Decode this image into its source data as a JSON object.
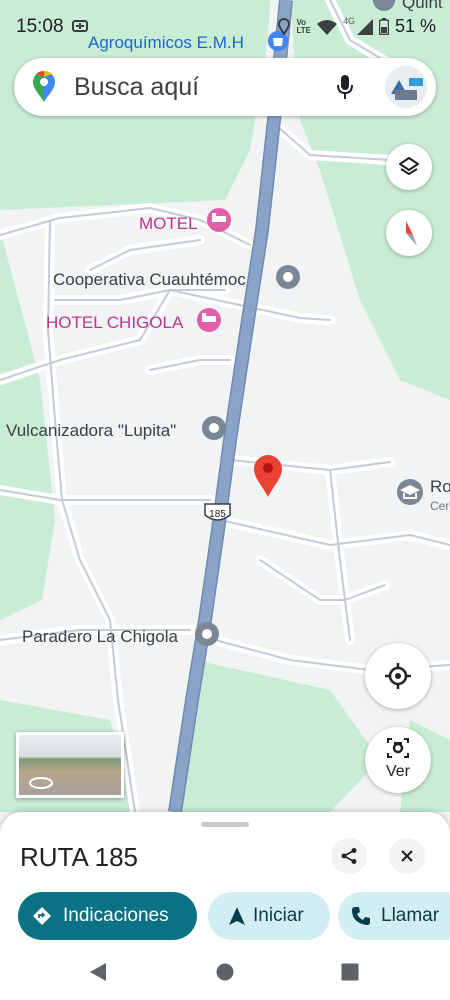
{
  "status_bar": {
    "time": "15:08",
    "battery": "51 %",
    "network_small_label": "Vo\nLTE",
    "network_gen": "4G"
  },
  "search": {
    "placeholder": "Busca aquí"
  },
  "map": {
    "pois": [
      {
        "id": "agroquimicos",
        "label": "Agroquímicos E.M.H",
        "category": "shop"
      },
      {
        "id": "quinta",
        "label": "Quint",
        "category": "place"
      },
      {
        "id": "motel",
        "label": "MOTEL",
        "category": "lodging"
      },
      {
        "id": "cooperativa",
        "label": "Cooperativa Cuauhtémoc",
        "category": "place"
      },
      {
        "id": "hotel-chigola",
        "label": "HOTEL CHIGOLA",
        "category": "lodging"
      },
      {
        "id": "vulcanizadora",
        "label": "Vulcanizadora \"Lupita\"",
        "category": "place"
      },
      {
        "id": "school",
        "label": "Ro",
        "sublabel": "Cer",
        "category": "school"
      },
      {
        "id": "paradero",
        "label": "Paradero La Chigola",
        "category": "place"
      }
    ],
    "highway_shield": "185",
    "colors": {
      "land": "#f1f3f4",
      "park": "#c9ecd4",
      "highway": "#8aa4c8",
      "highway_edge": "#6f8bb3",
      "local_road": "#c3cbd6",
      "pin": "#ea4335",
      "lodging": "#c2338f"
    }
  },
  "controls": {
    "streetview_button_label": "Ver"
  },
  "sheet": {
    "title": "RUTA 185",
    "actions": [
      {
        "id": "directions",
        "label": "Indicaciones"
      },
      {
        "id": "start",
        "label": "Iniciar"
      },
      {
        "id": "call",
        "label": "Llamar"
      }
    ],
    "colors": {
      "primary": "#0b7285",
      "secondary_bg": "#d3eef3",
      "secondary_text": "#0b5e6e"
    }
  }
}
